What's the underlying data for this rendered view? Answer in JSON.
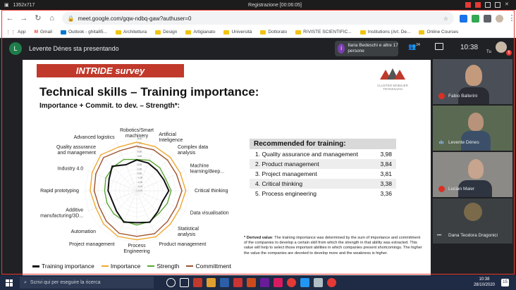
{
  "recorder": {
    "size": "1352x717",
    "title": "Registrazione [00:06:05]"
  },
  "browser": {
    "url": "meet.google.com/gqw-ndbq-gaw?authuser=0",
    "bookmarks": [
      "App",
      "Gmail",
      "Outlook - ghita85...",
      "Architettura",
      "Design",
      "Artigianato",
      "Università",
      "Dottorato",
      "RIVISTE SCIENTIFIC...",
      "Institutions (Art. De...",
      "Online Courses"
    ]
  },
  "meet": {
    "presenter_initial": "L",
    "presenting_text": "Levente Dénes sta presentando",
    "notification_initial": "i",
    "notification_text": "Ilaria Bedeschi e altre 17 persone",
    "people_count": "24",
    "clock": "10:38",
    "self_label": "Tu",
    "self_badge": "5",
    "participants": [
      {
        "name": "Fabio Ballerini",
        "mic_muted": true
      },
      {
        "name": "Levente Dénes",
        "mic_muted": false
      },
      {
        "name": "Lucian Maier",
        "mic_muted": true
      },
      {
        "name": "Dana Teodora Dragonici",
        "mic_muted": false
      }
    ]
  },
  "slide": {
    "banner": "INTRIDE survey",
    "logo_text": "CLUSTER MOBILIER TRANSILVAN",
    "title": "Technical skills – Training importance:",
    "subtitle": "Importance + Commit. to dev. – Strength*:",
    "table_header": "Recommended for training:",
    "recommended": [
      {
        "label": "1. Quality assurance and management",
        "value": "3,98"
      },
      {
        "label": "2. Product management",
        "value": "3,84"
      },
      {
        "label": "3. Project management",
        "value": "3,81"
      },
      {
        "label": "4. Critical thinking",
        "value": "3,38"
      },
      {
        "label": "5. Process engineering",
        "value": "3,36"
      }
    ],
    "note_bold": "* Derived value",
    "note_text": ": The training importance was determined by the sum of importance and commitment of the companies to develop a certain skill from which the strength in that ability was extracted. This value will help to select those important abilities in which companies present shortcomings. The higher the value the companies are devoted to develop more and the weakness is higher."
  },
  "chart_data": {
    "type": "radar",
    "axes": [
      "Robotics/Smart machinery",
      "Artificial Inteligence",
      "Complex data analysis",
      "Machine learning/deep...",
      "Critical thinking",
      "Data visualisation",
      "Statistical analysis",
      "Product management",
      "Process Engineering",
      "Project management",
      "Automation",
      "Additive manufacturing/3D...",
      "Rapid prototyping",
      "Industry 4.0",
      "Quality assurance and management",
      "Advanced logistics"
    ],
    "ticks": [
      "-4,00",
      "-3,00",
      "-2,00",
      "-1,00",
      "0,00",
      "1,00",
      "2,00",
      "3,00",
      "4,00",
      "5,00",
      "6,00",
      "7,00",
      "8,00"
    ],
    "rlim": [
      -4,
      8
    ],
    "series": [
      {
        "name": "Training importance",
        "color": "#111111",
        "values": [
          3.1,
          2.9,
          2.6,
          2.7,
          3.38,
          2.4,
          2.8,
          3.84,
          3.36,
          3.81,
          2.6,
          2.1,
          2.6,
          2.9,
          3.98,
          2.5
        ]
      },
      {
        "name": "Importance",
        "color": "#f0a830",
        "values": [
          7.2,
          7.0,
          6.9,
          6.8,
          7.3,
          6.7,
          6.9,
          7.5,
          7.3,
          7.4,
          6.8,
          6.2,
          6.7,
          7.1,
          7.7,
          6.9
        ]
      },
      {
        "name": "Strength",
        "color": "#5aa532",
        "values": [
          3.2,
          3.6,
          3.5,
          3.2,
          3.9,
          3.6,
          3.3,
          3.7,
          3.9,
          3.6,
          3.5,
          3.4,
          3.4,
          3.7,
          3.7,
          3.8
        ]
      },
      {
        "name": "Committment",
        "color": "#a0522d",
        "values": [
          6.3,
          6.2,
          6.0,
          5.9,
          6.4,
          5.8,
          6.0,
          6.7,
          6.5,
          6.6,
          5.9,
          5.4,
          5.8,
          6.2,
          6.8,
          6.0
        ]
      }
    ],
    "legend_position": "bottom"
  },
  "taskbar": {
    "search_placeholder": "Scrivi qui per eseguire la ricerca",
    "time": "10:38",
    "date": "28/10/2020",
    "notifications": "15"
  },
  "colors": {
    "meet_bg": "#202124",
    "banner_red": "#c0392b",
    "recording_red": "#e53935",
    "taskbar": "#1f2a44"
  }
}
